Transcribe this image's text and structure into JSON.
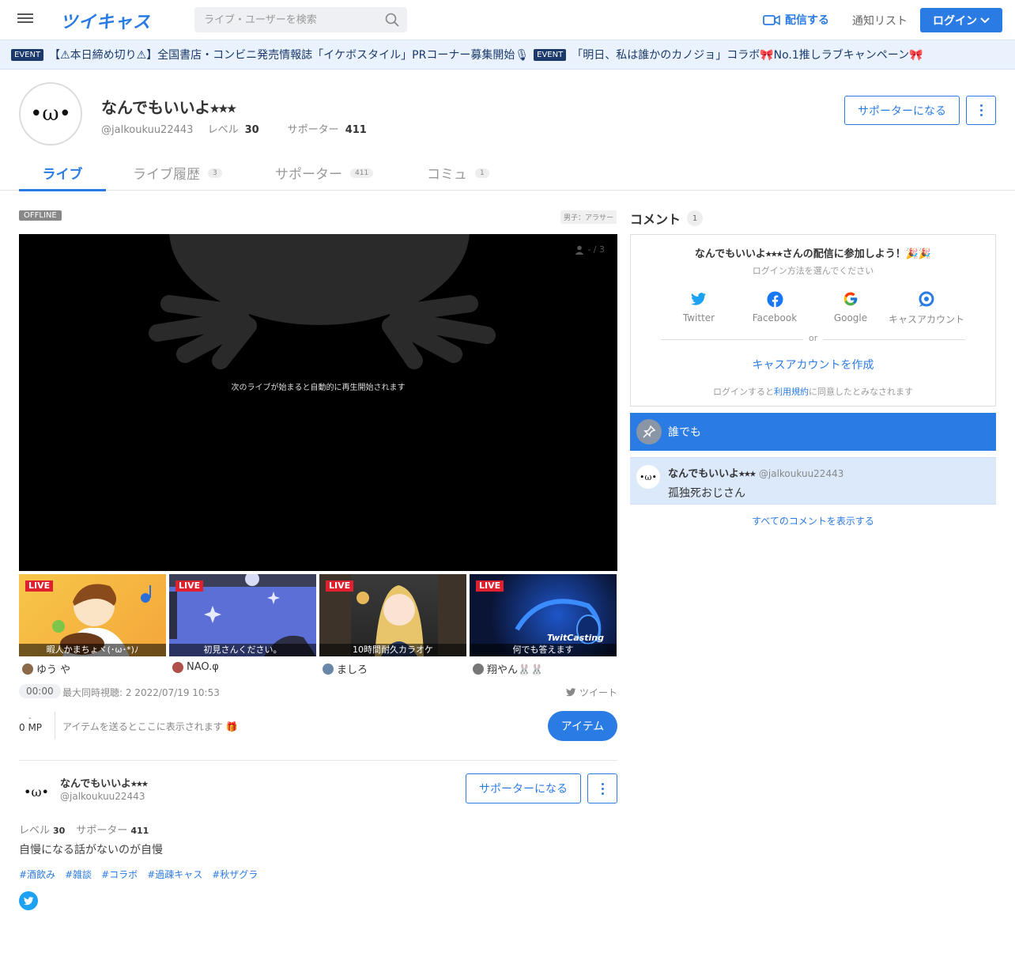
{
  "header": {
    "logo": "ツイキャス",
    "search_placeholder": "ライブ・ユーザーを検索",
    "broadcast_label": "配信する",
    "notifications_label": "通知リスト",
    "login_label": "ログイン"
  },
  "events": [
    {
      "badge": "EVENT",
      "text": "【⚠本日締め切り⚠】全国書店・コンビニ発売情報誌「イケボスタイル」PRコーナー募集開始🎙"
    },
    {
      "badge": "EVENT",
      "text": "「明日、私は誰かのカノジョ」コラボ🎀No.1推しラブキャンペーン🎀"
    }
  ],
  "profile": {
    "avatar_face": "•ω•",
    "name": "なんでもいいよ⭑⭑⭑",
    "handle": "@jalkoukuu22443",
    "level_label": "レベル",
    "level": "30",
    "supporters_label": "サポーター",
    "supporters": "411",
    "become_supporter": "サポーターになる"
  },
  "tabs": [
    {
      "label": "ライブ",
      "count": ""
    },
    {
      "label": "ライブ履歴",
      "count": "3"
    },
    {
      "label": "サポーター",
      "count": "411"
    },
    {
      "label": "コミュ",
      "count": "1"
    }
  ],
  "live": {
    "status": "OFFLINE",
    "category": "男子：アラサー",
    "viewers": "- / 3",
    "message": "次のライブが始まると自動的に再生開始されます",
    "time": "00:00",
    "stats": "最大同時視聴: 2   2022/07/19 10:53",
    "tweet_label": "ツイート",
    "mp_dash": "-",
    "mp": "0 MP",
    "item_hint": "アイテムを送るとここに表示されます 🎁",
    "item_button": "アイテム"
  },
  "recommended": [
    {
      "badge": "LIVE",
      "caption": "暇人かまちょヾ(･ω･*)ﾉ",
      "user": "ゆう や"
    },
    {
      "badge": "LIVE",
      "caption": "初見さんください。",
      "user": "NAO.φ"
    },
    {
      "badge": "LIVE",
      "caption": "10時間耐久カラオケ",
      "user": "ましろ"
    },
    {
      "badge": "LIVE",
      "caption": "何でも答えます",
      "user": "翔やん🐰🐰",
      "logo_text": "TwitCasting"
    }
  ],
  "profile_card": {
    "avatar_face": "•ω•",
    "name": "なんでもいいよ⭑⭑⭑",
    "handle": "@jalkoukuu22443",
    "level_label": "レベル",
    "level": "30",
    "supporters_label": "サポーター",
    "supporters": "411",
    "become_supporter": "サポーターになる",
    "bio": "自慢になる話がないのが自慢",
    "tags": [
      "#酒飲み",
      "#雑談",
      "#コラボ",
      "#過疎キャス",
      "#秋ザグラ"
    ]
  },
  "comments": {
    "title": "コメント",
    "count": "1",
    "login_title": "なんでもいいよ⭑⭑⭑さんの配信に参加しよう！🎉🎉",
    "login_sub": "ログイン方法を選んでください",
    "providers": [
      "Twitter",
      "Facebook",
      "Google",
      "キャスアカウント"
    ],
    "or": "or",
    "create_account": "キャスアカウントを作成",
    "terms_prefix": "ログインすると",
    "terms_link": "利用規約",
    "terms_suffix": "に同意したとみなされます",
    "audience": "誰でも",
    "items": [
      {
        "avatar_face": "•ω•",
        "name": "なんでもいいよ⭑⭑⭑",
        "handle": "@jalkoukuu22443",
        "text": "孤独死おじさん"
      }
    ],
    "show_all": "すべてのコメントを表示する"
  },
  "colors": {
    "accent": "#2b7be4",
    "live_badge": "#e0202e",
    "event_bg": "#eaf2fd",
    "comment_highlight": "#dce9fb"
  }
}
